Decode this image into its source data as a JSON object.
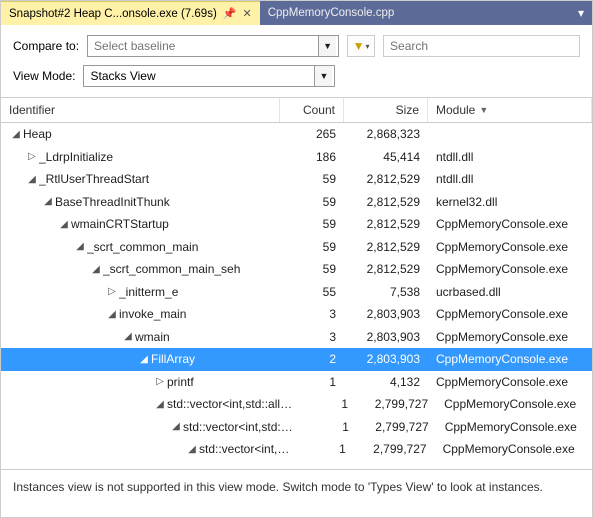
{
  "tabs": {
    "active": "Snapshot#2 Heap C...onsole.exe (7.69s)",
    "inactive": "CppMemoryConsole.cpp"
  },
  "toolbar": {
    "compare_label": "Compare to:",
    "baseline_placeholder": "Select baseline",
    "search_placeholder": "Search",
    "viewmode_label": "View Mode:",
    "viewmode_value": "Stacks View"
  },
  "columns": {
    "identifier": "Identifier",
    "count": "Count",
    "size": "Size",
    "module": "Module"
  },
  "rows": [
    {
      "depth": 0,
      "toggle": "expanded",
      "name": "Heap",
      "count": "265",
      "size": "2,868,323",
      "module": ""
    },
    {
      "depth": 1,
      "toggle": "collapsed",
      "name": "_LdrpInitialize",
      "count": "186",
      "size": "45,414",
      "module": "ntdll.dll"
    },
    {
      "depth": 1,
      "toggle": "expanded",
      "name": "_RtlUserThreadStart",
      "count": "59",
      "size": "2,812,529",
      "module": "ntdll.dll"
    },
    {
      "depth": 2,
      "toggle": "expanded",
      "name": "BaseThreadInitThunk",
      "count": "59",
      "size": "2,812,529",
      "module": "kernel32.dll"
    },
    {
      "depth": 3,
      "toggle": "expanded",
      "name": "wmainCRTStartup",
      "count": "59",
      "size": "2,812,529",
      "module": "CppMemoryConsole.exe"
    },
    {
      "depth": 4,
      "toggle": "expanded",
      "name": "_scrt_common_main",
      "count": "59",
      "size": "2,812,529",
      "module": "CppMemoryConsole.exe"
    },
    {
      "depth": 5,
      "toggle": "expanded",
      "name": "_scrt_common_main_seh",
      "count": "59",
      "size": "2,812,529",
      "module": "CppMemoryConsole.exe"
    },
    {
      "depth": 6,
      "toggle": "collapsed",
      "name": "_initterm_e",
      "count": "55",
      "size": "7,538",
      "module": "ucrbased.dll"
    },
    {
      "depth": 6,
      "toggle": "expanded",
      "name": "invoke_main",
      "count": "3",
      "size": "2,803,903",
      "module": "CppMemoryConsole.exe"
    },
    {
      "depth": 7,
      "toggle": "expanded",
      "name": "wmain",
      "count": "3",
      "size": "2,803,903",
      "module": "CppMemoryConsole.exe"
    },
    {
      "depth": 8,
      "toggle": "expanded",
      "name": "FillArray",
      "count": "2",
      "size": "2,803,903",
      "module": "CppMemoryConsole.exe",
      "selected": true
    },
    {
      "depth": 9,
      "toggle": "collapsed",
      "name": "printf",
      "count": "1",
      "size": "4,132",
      "module": "CppMemoryConsole.exe"
    },
    {
      "depth": 9,
      "toggle": "expanded",
      "name": "std::vector<int,std::alloc...",
      "count": "1",
      "size": "2,799,727",
      "module": "CppMemoryConsole.exe"
    },
    {
      "depth": 10,
      "toggle": "expanded",
      "name": "std::vector<int,std::al...",
      "count": "1",
      "size": "2,799,727",
      "module": "CppMemoryConsole.exe"
    },
    {
      "depth": 11,
      "toggle": "expanded",
      "name": "std::vector<int,st...",
      "count": "1",
      "size": "2,799,727",
      "module": "CppMemoryConsole.exe"
    }
  ],
  "status": "Instances view is not supported in this view mode. Switch mode to 'Types View' to look at instances."
}
